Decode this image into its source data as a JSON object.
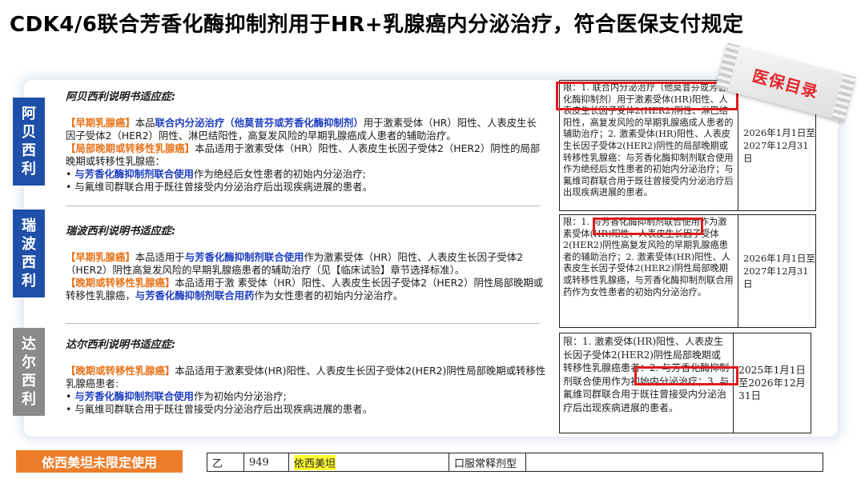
{
  "title": "CDK4/6联合芳香化酶抑制剂用于HR+乳腺癌内分泌治疗，符合医保支付规定",
  "stamp": "医保目录",
  "sections": [
    {
      "side_label": "阿贝西利",
      "heading": "阿贝西利说明书适应症:",
      "p1_tag": "【早期乳腺癌】",
      "p1_a": "本品",
      "p1_b": "联合内分泌治疗（他莫昔芬或芳香化酶抑制剂）",
      "p1_c": "用于激素受体（HR）阳性、人表皮生长因子受体2（HER2）阴性、淋巴结阳性，高复发风险的早期乳腺癌成人患者的辅助治疗。",
      "p2_tag": "【局部晚期或转移性乳腺癌】",
      "p2_a": "本品适用于激素受体（HR）阳性、人表皮生长因子受体2（HER2）阴性的局部晚期或转移性乳腺癌：",
      "b1_a": "• ",
      "b1_b": "与芳香化酶抑制剂联合使用",
      "b1_c": "作为绝经后女性患者的初始内分泌治疗;",
      "b2": "• 与氟维司群联合用于既往曾接受内分泌治疗后出现疾病进展的患者。",
      "limit": "限：1. 联合内分泌治疗（他莫昔芬或芳香化酶抑制剂）用于激素受体(HR)阳性、人表皮生长因子受体2(HER2)阴性、淋巴结阳性，高复发风险的早期乳腺癌成人患者的辅助治疗；2. 激素受体(HR)阳性、人表皮生长因子受体2(HER2)阴性的局部晚期或转移性乳腺癌：与芳香化酶抑制剂联合使用作为绝经后女性患者的初始内分泌治疗；与氟维司群联合用于既往曾接受内分泌治疗后出现疾病进展的患者。",
      "date": "2026年1月1日至2027年12月31日"
    },
    {
      "side_label": "瑞波西利",
      "heading": "瑞波西利说明书适应症:",
      "p1_tag": "【早期乳腺癌】",
      "p1_a": "本品适用于",
      "p1_b": "与芳香化酶抑制剂联合使用",
      "p1_c": "作为激素受体（HR）阳性、人表皮生长因子受体2（HER2）阴性高复发风险的早期乳腺癌患者的辅助治疗（见【临床试验】章节选择标准）。",
      "p2_tag": "【晚期或转移性乳腺癌】",
      "p2_a": "本品适用于激 素受体（HR）阳性、人表皮生长因子受体2（HER2）阴性局部晚期或转移性乳腺癌，",
      "p2_b": "与芳香化酶抑制剂联合用药",
      "p2_c": "作为女性患者的初始内分泌治疗。",
      "limit": "限：1. 与芳香化酶抑制剂联合使用作为激素受体(HR)阳性、人表皮生长因子受体2(HER2)阴性高复发风险的早期乳腺癌患者的辅助治疗；2. 激素受体(HR)阳性、人表皮生长因子受体2(HER2)阴性局部晚期或转移性乳腺癌，与芳香化酶抑制剂联合用药作为女性患者的初始内分泌治疗。",
      "date": "2026年1月1日至2027年12月31日"
    },
    {
      "side_label": "达尔西利",
      "heading": "达尔西利说明书适应症:",
      "p1_tag": "【晚期或转移性乳腺癌】",
      "p1_a": "本品适用于激素受体(HR)阳性、人表皮生长因子受体2(HER2)阴性局部晚期或转移性乳腺癌患者:",
      "b1_a": "• ",
      "b1_b": "与芳香化酶抑制剂联合使用",
      "b1_c": "作为初始内分泌治疗;",
      "b2": "• 与氟维司群联合用于既往曾接受内分泌治疗后出现疾病进展的患者。",
      "limit": "限：1. 激素受体(HR)阳性、人表皮生长因子受体2(HER2)阴性局部晚期或转移性乳腺癌患者：2. 与芳香化酶抑制剂联合使用作为初始内分泌治疗；3. 与氟维司群联合用于既往曾接受内分泌治疗后出现疾病进展的患者。",
      "date": "2025年1月1日至2026年12月31日"
    }
  ],
  "bottom": {
    "label": "依西美坦未限定使用",
    "category": "乙",
    "number": "949",
    "drug": "依西美坦",
    "form": "口服常释剂型",
    "remark": ""
  }
}
